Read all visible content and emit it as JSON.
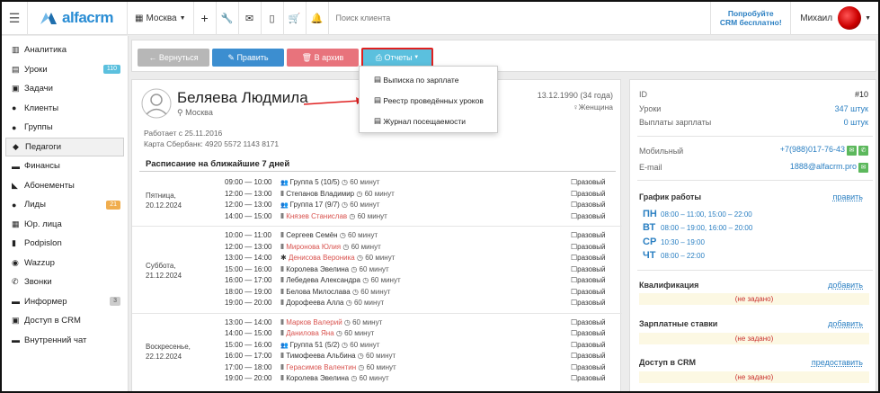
{
  "topbar": {
    "logo_text": "alfacrm",
    "city": "Москва",
    "search_placeholder": "Поиск клиента",
    "promo_line1": "Попробуйте",
    "promo_line2": "CRM бесплатно!",
    "user_name": "Михаил"
  },
  "sidebar": {
    "items": [
      {
        "label": "Аналитика",
        "icon": "chart-icon"
      },
      {
        "label": "Уроки",
        "icon": "calendar-icon",
        "badge": "110"
      },
      {
        "label": "Задачи",
        "icon": "tasks-icon"
      },
      {
        "label": "Клиенты",
        "icon": "user-icon"
      },
      {
        "label": "Группы",
        "icon": "group-icon"
      },
      {
        "label": "Педагоги",
        "icon": "teacher-icon"
      },
      {
        "label": "Финансы",
        "icon": "money-icon"
      },
      {
        "label": "Абонементы",
        "icon": "tag-icon"
      },
      {
        "label": "Лиды",
        "icon": "leads-icon",
        "badge": "21"
      },
      {
        "label": "Юр. лица",
        "icon": "building-icon"
      },
      {
        "label": "Podpislon",
        "icon": "doc-icon"
      },
      {
        "label": "Wazzup",
        "icon": "whatsapp-icon"
      },
      {
        "label": "Звонки",
        "icon": "phone-icon"
      },
      {
        "label": "Информер",
        "icon": "informer-icon",
        "badge": "3"
      },
      {
        "label": "Доступ в CRM",
        "icon": "lock-icon"
      },
      {
        "label": "Внутренний чат",
        "icon": "chat-icon"
      }
    ]
  },
  "toolbar": {
    "back": "← Вернуться",
    "edit": "✎ Править",
    "archive": "🗑 В архив",
    "reports": "Отчеты"
  },
  "reports_menu": [
    "Выписка по зарплате",
    "Реестр проведённых уроков",
    "Журнал посещаемости"
  ],
  "teacher": {
    "name": "Беляева Людмила",
    "city": "Москва",
    "birth": "13.12.1990 (34 года)",
    "gender": "Женщина",
    "works_since": "Работает с 25.11.2016",
    "card": "Карта Сбербанк: 4920 5572 1143 8171"
  },
  "schedule": {
    "title": "Расписание на ближайшие 7 дней",
    "days": [
      {
        "day": "Пятница,",
        "date": "20.12.2024",
        "rows": [
          {
            "time": "09:00 — 10:00",
            "who": "Группа 5 (10/5)",
            "kind": "group",
            "dur": "60 минут",
            "tag": "разовый"
          },
          {
            "time": "12:00 — 13:00",
            "who": "Степанов Владимир",
            "kind": "client",
            "dur": "60 минут",
            "tag": "разовый"
          },
          {
            "time": "12:00 — 13:00",
            "who": "Группа 17 (9/7)",
            "kind": "group",
            "dur": "60 минут",
            "tag": "разовый"
          },
          {
            "time": "14:00 — 15:00",
            "who": "Князев Станислав",
            "kind": "client-red",
            "dur": "60 минут",
            "tag": "разовый"
          }
        ]
      },
      {
        "day": "Суббота,",
        "date": "21.12.2024",
        "rows": [
          {
            "time": "10:00 — 11:00",
            "who": "Сергеев Семён",
            "kind": "client",
            "dur": "60 минут",
            "tag": "разовый"
          },
          {
            "time": "12:00 — 13:00",
            "who": "Миронова Юлия",
            "kind": "client-red",
            "dur": "60 минут",
            "tag": "разовый"
          },
          {
            "time": "13:00 — 14:00",
            "who": "Денисова Вероника",
            "kind": "trial-red",
            "dur": "60 минут",
            "tag": "разовый"
          },
          {
            "time": "15:00 — 16:00",
            "who": "Королева Эвелина",
            "kind": "client",
            "dur": "60 минут",
            "tag": "разовый"
          },
          {
            "time": "16:00 — 17:00",
            "who": "Лебедева Александра",
            "kind": "client",
            "dur": "60 минут",
            "tag": "разовый"
          },
          {
            "time": "18:00 — 19:00",
            "who": "Белова Милослава",
            "kind": "client",
            "dur": "60 минут",
            "tag": "разовый"
          },
          {
            "time": "19:00 — 20:00",
            "who": "Дорофеева Алла",
            "kind": "client",
            "dur": "60 минут",
            "tag": "разовый"
          }
        ]
      },
      {
        "day": "Воскресенье,",
        "date": "22.12.2024",
        "rows": [
          {
            "time": "13:00 — 14:00",
            "who": "Марков Валерий",
            "kind": "client-red",
            "dur": "60 минут",
            "tag": "разовый"
          },
          {
            "time": "14:00 — 15:00",
            "who": "Данилова Яна",
            "kind": "client-red",
            "dur": "60 минут",
            "tag": "разовый"
          },
          {
            "time": "15:00 — 16:00",
            "who": "Группа 51 (5/2)",
            "kind": "group",
            "dur": "60 минут",
            "tag": "разовый"
          },
          {
            "time": "16:00 — 17:00",
            "who": "Тимофеева Альбина",
            "kind": "client",
            "dur": "60 минут",
            "tag": "разовый"
          },
          {
            "time": "17:00 — 18:00",
            "who": "Герасимов Валентин",
            "kind": "client-red",
            "dur": "60 минут",
            "tag": "разовый"
          },
          {
            "time": "19:00 — 20:00",
            "who": "Королева Эвелина",
            "kind": "client",
            "dur": "60 минут",
            "tag": "разовый"
          }
        ]
      }
    ]
  },
  "right_panel": {
    "id_label": "ID",
    "id_value": "#10",
    "lessons_label": "Уроки",
    "lessons_value": "347 штук",
    "payouts_label": "Выплаты зарплаты",
    "payouts_value": "0 штук",
    "mobile_label": "Мобильный",
    "mobile_value": "+7(988)017-76-43",
    "email_label": "E-mail",
    "email_value": "1888@alfacrm.pro",
    "schedule_title": "График работы",
    "schedule_link": "править",
    "work": [
      {
        "dow": "ПН",
        "time": "08:00 – 11:00, 15:00 – 22:00"
      },
      {
        "dow": "ВТ",
        "time": "08:00 – 19:00, 16:00 – 20:00"
      },
      {
        "dow": "СР",
        "time": "10:30 – 19:00"
      },
      {
        "dow": "ЧТ",
        "time": "08:00 – 22:00"
      }
    ],
    "qual_title": "Квалификация",
    "qual_link": "добавить",
    "qual_value": "(не задано)",
    "rate_title": "Зарплатные ставки",
    "rate_link": "добавить",
    "rate_value": "(не задано)",
    "access_title": "Доступ в CRM",
    "access_link": "предоставить",
    "access_value": "(не задано)"
  },
  "colors": {
    "accent": "#2a7fc2",
    "reports_btn": "#5bc0de",
    "highlight": "#e02020"
  }
}
